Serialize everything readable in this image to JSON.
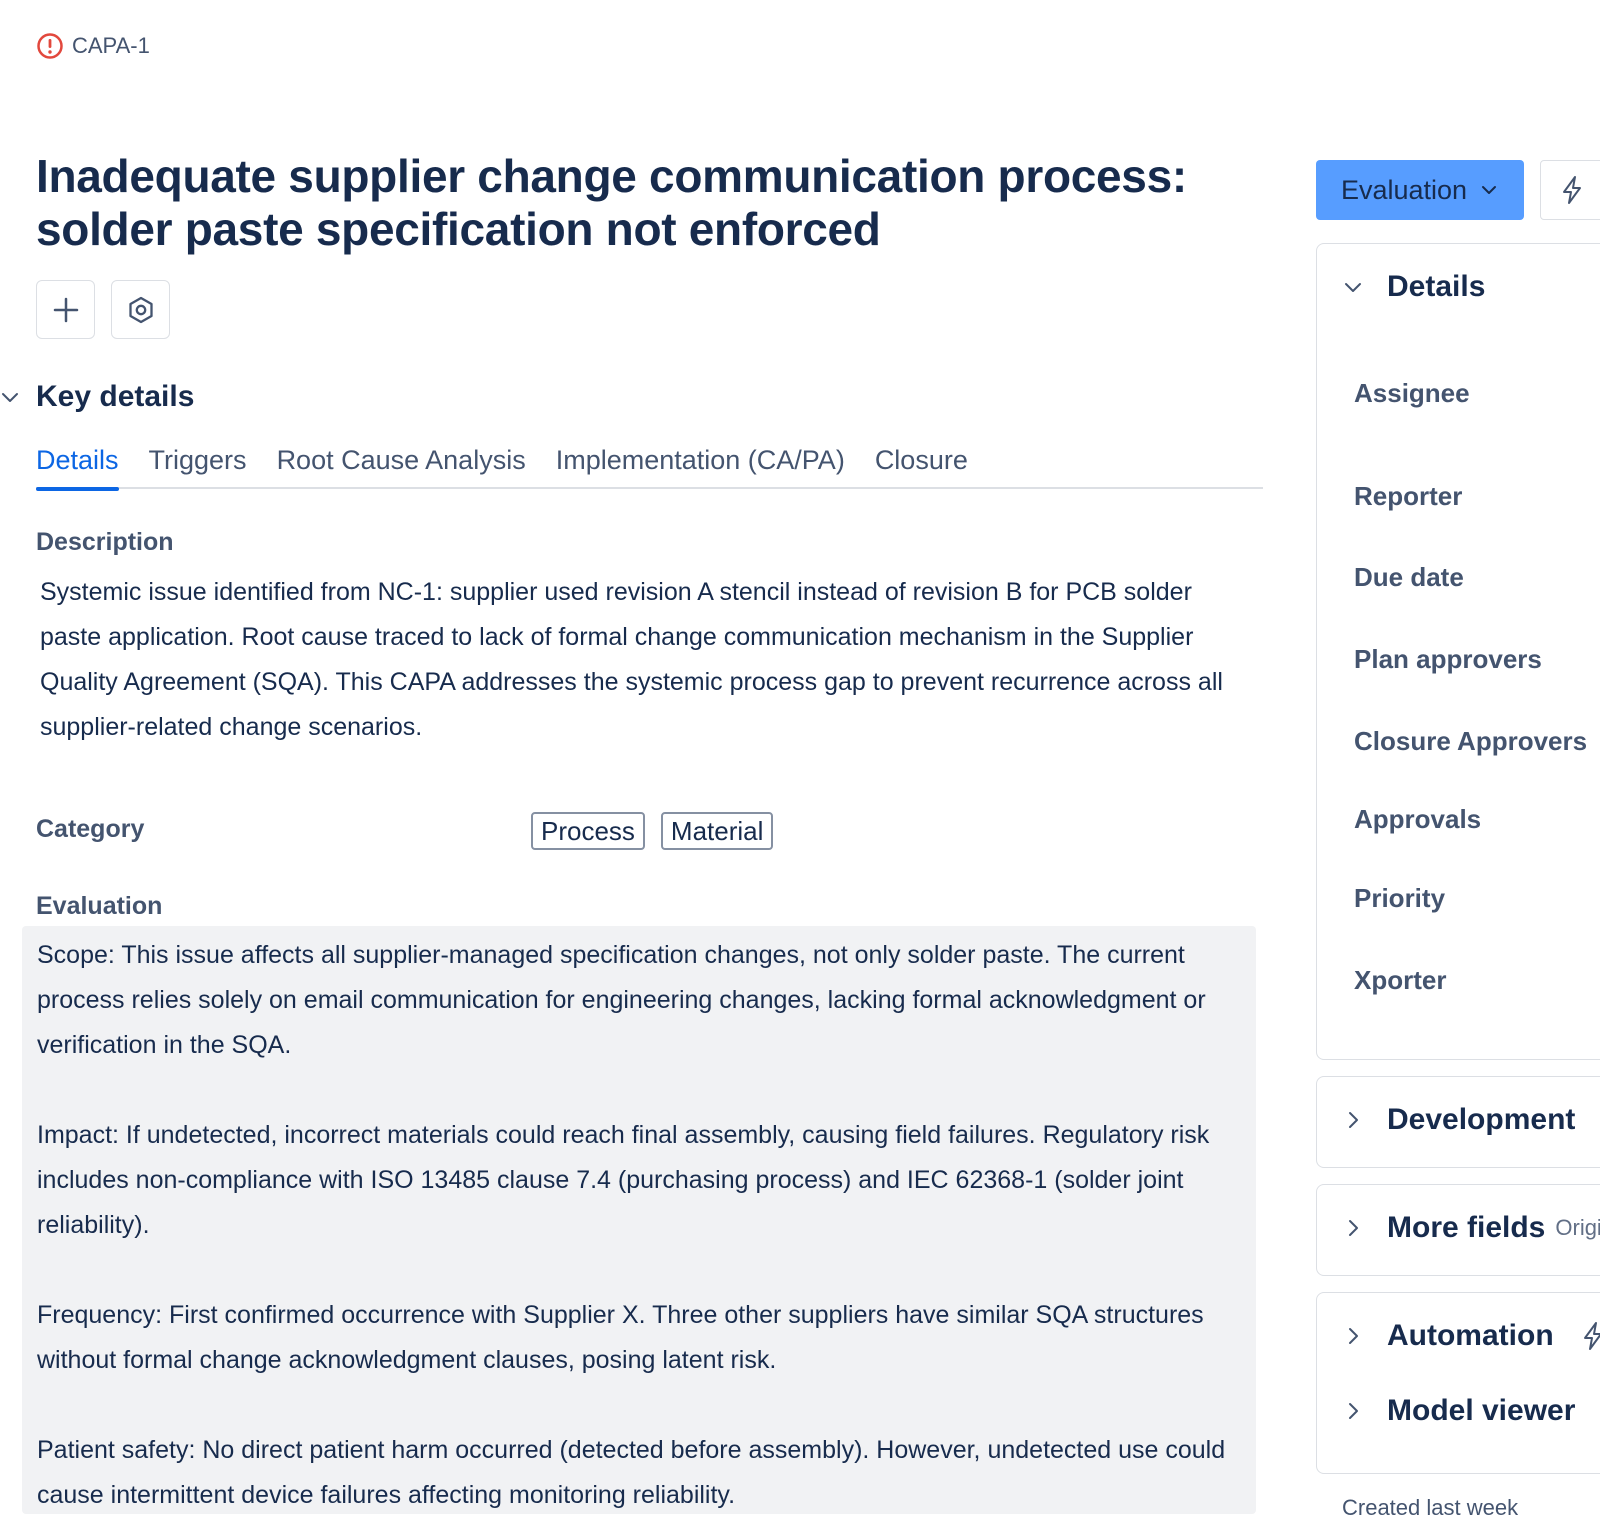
{
  "breadcrumb": {
    "key": "CAPA-1",
    "icon": "alert-circle-icon"
  },
  "title": "Inadequate supplier change communication process: solder paste specification not enforced",
  "actions": {
    "add_icon": "plus-icon",
    "settings_icon": "settings-hex-icon"
  },
  "key_details": {
    "heading": "Key details",
    "tabs": [
      {
        "label": "Details",
        "active": true
      },
      {
        "label": "Triggers",
        "active": false
      },
      {
        "label": "Root Cause Analysis",
        "active": false
      },
      {
        "label": "Implementation (CA/PA)",
        "active": false
      },
      {
        "label": "Closure",
        "active": false
      }
    ]
  },
  "description": {
    "label": "Description",
    "text": "Systemic issue identified from NC-1: supplier used revision A stencil instead of revision B for PCB solder paste application. Root cause traced to lack of formal change communication mechanism in the Supplier Quality Agreement (SQA). This CAPA addresses the systemic process gap to prevent recurrence across all supplier-related change scenarios."
  },
  "category": {
    "label": "Category",
    "tags": [
      "Process",
      "Material"
    ]
  },
  "evaluation": {
    "label": "Evaluation",
    "paragraphs": [
      "Scope: This issue affects all supplier-managed specification changes, not only solder paste. The current process relies solely on email communication for engineering changes, lacking formal acknowledgment or verification in the SQA.",
      "Impact: If undetected, incorrect materials could reach final assembly, causing field failures. Regulatory risk includes non-compliance with ISO 13485 clause 7.4 (purchasing process) and IEC 62368-1 (solder joint reliability).",
      "Frequency: First confirmed occurrence with Supplier X. Three other suppliers have similar SQA structures without formal change acknowledgment clauses, posing latent risk.",
      "Patient safety: No direct patient harm occurred (detected before assembly). However, undetected use could cause intermittent device failures affecting monitoring reliability."
    ]
  },
  "sidebar": {
    "status": "Evaluation",
    "details_heading": "Details",
    "fields": [
      "Assignee",
      "Reporter",
      "Due date",
      "Plan approvers",
      "Closure Approvers",
      "Approvals",
      "Priority",
      "Xporter"
    ],
    "development_heading": "Development",
    "more_fields_heading": "More fields",
    "more_fields_hint": "Origi",
    "automation_heading": "Automation",
    "model_viewer_heading": "Model viewer",
    "created": "Created last week"
  },
  "colors": {
    "accent": "#0c66e4",
    "status_bg": "#579dff",
    "eval_bg": "#f1f2f4",
    "alert": "#e2483d"
  }
}
